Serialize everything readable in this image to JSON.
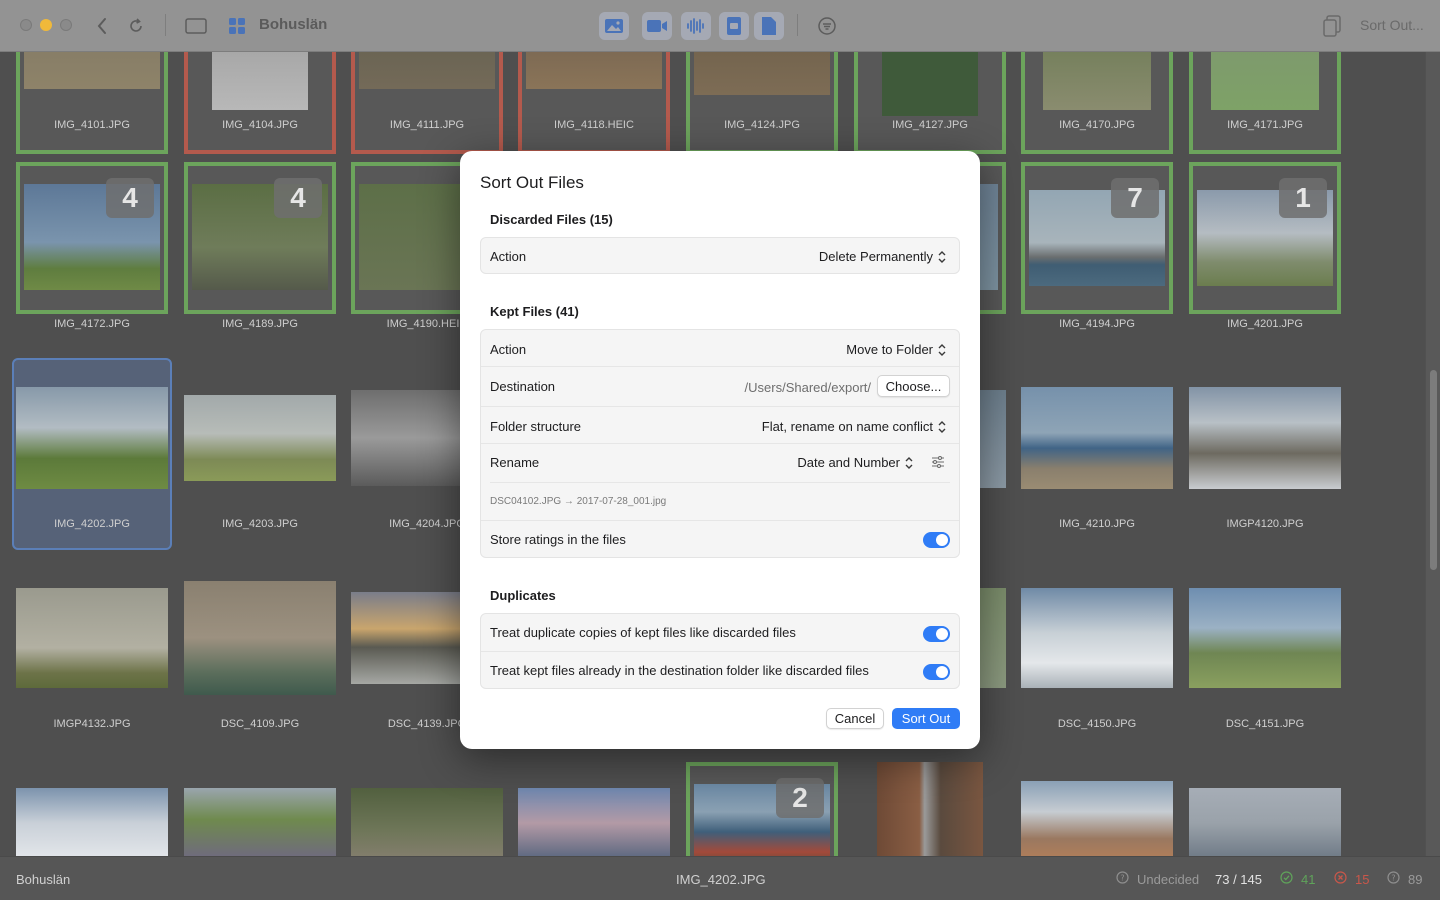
{
  "window": {
    "title": "Bohuslän"
  },
  "toolbar": {
    "title": "Bohuslän",
    "sort_out_label": "Sort Out...",
    "media_filters": [
      "image-icon",
      "video-icon",
      "audio-icon",
      "raw-icon",
      "document-icon"
    ]
  },
  "grid": {
    "row1": [
      "IMG_4101.JPG",
      "IMG_4104.JPG",
      "IMG_4111.JPG",
      "IMG_4118.HEIC",
      "IMG_4124.JPG",
      "IMG_4127.JPG",
      "IMG_4170.JPG",
      "IMG_4171.JPG"
    ],
    "row2": [
      "IMG_4172.JPG",
      "IMG_4189.JPG",
      "IMG_4190.HEIC",
      "",
      "",
      "",
      "IMG_4194.JPG",
      "IMG_4201.JPG"
    ],
    "row2_badges": [
      "4",
      "4",
      "",
      "",
      "",
      "",
      "7",
      "1"
    ],
    "row3": [
      "IMG_4202.JPG",
      "IMG_4203.JPG",
      "IMG_4204.JPG",
      "",
      "",
      "",
      "IMG_4210.JPG",
      "IMGP4120.JPG"
    ],
    "row4": [
      "IMGP4132.JPG",
      "DSC_4109.JPG",
      "DSC_4139.JPG",
      "",
      "",
      "",
      "DSC_4150.JPG",
      "DSC_4151.JPG"
    ],
    "row5_badge": "2"
  },
  "status": {
    "folder": "Bohuslän",
    "current_file": "IMG_4202.JPG",
    "undecided_label": "Undecided",
    "position": "73 / 145",
    "kept_count": "41",
    "discarded_count": "15",
    "undecided_count": "89",
    "colors": {
      "kept": "#5fa35a",
      "discarded": "#c9574a"
    }
  },
  "dialog": {
    "title": "Sort Out Files",
    "discarded": {
      "title": "Discarded Files (15)",
      "action_label": "Action",
      "action_value": "Delete Permanently"
    },
    "kept": {
      "title": "Kept Files (41)",
      "action_label": "Action",
      "action_value": "Move to Folder",
      "destination_label": "Destination",
      "destination_value": "/Users/Shared/export/",
      "choose_label": "Choose...",
      "folder_structure_label": "Folder structure",
      "folder_structure_value": "Flat, rename on name conflict",
      "rename_label": "Rename",
      "rename_value": "Date and Number",
      "rename_example": "DSC04102.JPG → 2017-07-28_001.jpg",
      "store_ratings_label": "Store ratings in the files",
      "store_ratings_on": true
    },
    "duplicates": {
      "title": "Duplicates",
      "treat_copies_label": "Treat duplicate copies of kept files like discarded files",
      "treat_copies_on": true,
      "treat_existing_label": "Treat kept files already in the destination folder like discarded files",
      "treat_existing_on": true
    },
    "cancel_label": "Cancel",
    "sort_out_label": "Sort Out",
    "accent": "#2f7cf6"
  }
}
